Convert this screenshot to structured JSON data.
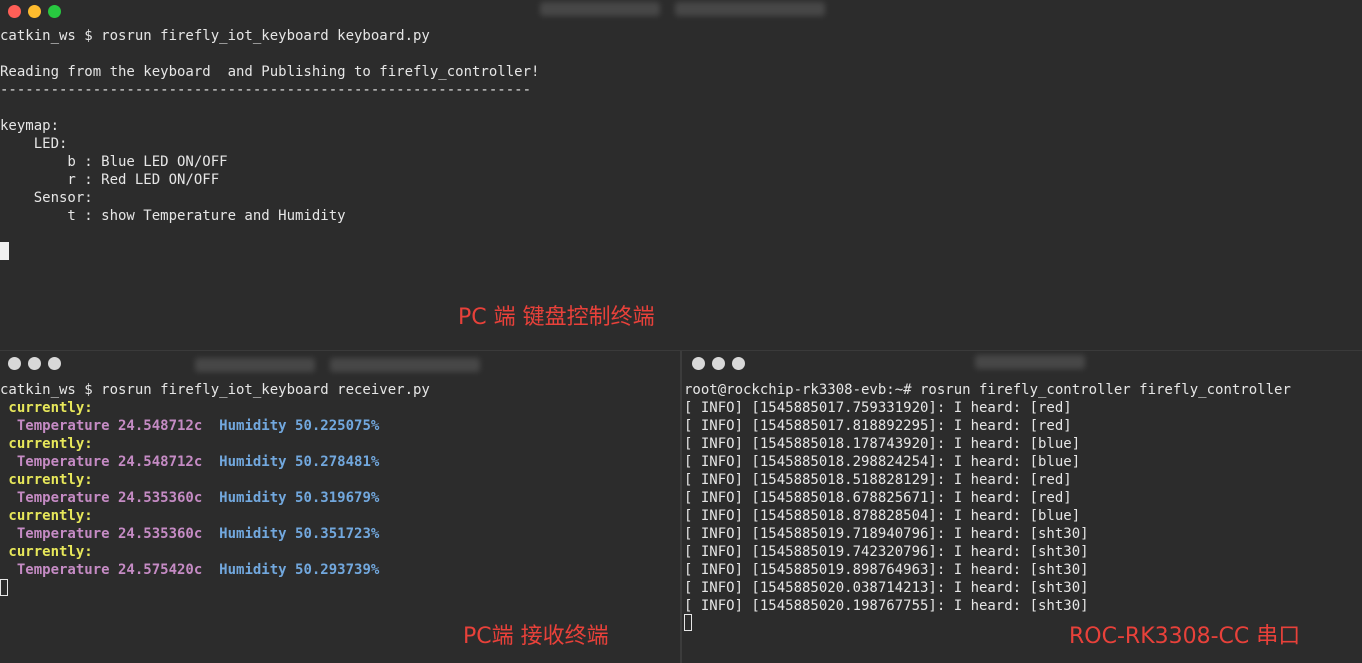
{
  "colors": {
    "close": "#ff5f57",
    "minimize": "#febc2e",
    "maximize": "#28c840",
    "inactive_dot": "#d8d8d8",
    "caption": "#e8413a",
    "currently": "#e7e75a",
    "temperature": "#c58bc4",
    "humidity": "#72a8de"
  },
  "keyboard_terminal": {
    "command": "catkin_ws $ rosrun firefly_iot_keyboard keyboard.py",
    "banner": "Reading from the keyboard  and Publishing to firefly_controller!",
    "separator": "---------------------------------------------------------------",
    "keymap_title": "keymap:",
    "led_title": "    LED:",
    "key_b": "        b : Blue LED ON/OFF",
    "key_r": "        r : Red LED ON/OFF",
    "sensor_title": "    Sensor:",
    "key_t": "        t : show Temperature and Humidity",
    "caption": "PC 端 键盘控制终端"
  },
  "receiver_terminal": {
    "command": "catkin_ws $ rosrun firefly_iot_keyboard receiver.py",
    "readings": [
      {
        "label": " currently:",
        "temperature": "  Temperature 24.548712c",
        "humidity": "Humidity 50.225075%"
      },
      {
        "label": " currently:",
        "temperature": "  Temperature 24.548712c",
        "humidity": "Humidity 50.278481%"
      },
      {
        "label": " currently:",
        "temperature": "  Temperature 24.535360c",
        "humidity": "Humidity 50.319679%"
      },
      {
        "label": " currently:",
        "temperature": "  Temperature 24.535360c",
        "humidity": "Humidity 50.351723%"
      },
      {
        "label": " currently:",
        "temperature": "  Temperature 24.575420c",
        "humidity": "Humidity 50.293739%"
      }
    ],
    "caption": "PC端 接收终端"
  },
  "serial_terminal": {
    "command": "root@rockchip-rk3308-evb:~# rosrun firefly_controller firefly_controller",
    "logs": [
      "[ INFO] [1545885017.759331920]: I heard: [red]",
      "[ INFO] [1545885017.818892295]: I heard: [red]",
      "[ INFO] [1545885018.178743920]: I heard: [blue]",
      "[ INFO] [1545885018.298824254]: I heard: [blue]",
      "[ INFO] [1545885018.518828129]: I heard: [red]",
      "[ INFO] [1545885018.678825671]: I heard: [red]",
      "[ INFO] [1545885018.878828504]: I heard: [blue]",
      "[ INFO] [1545885019.718940796]: I heard: [sht30]",
      "[ INFO] [1545885019.742320796]: I heard: [sht30]",
      "[ INFO] [1545885019.898764963]: I heard: [sht30]",
      "[ INFO] [1545885020.038714213]: I heard: [sht30]",
      "[ INFO] [1545885020.198767755]: I heard: [sht30]"
    ],
    "caption": "ROC-RK3308-CC 串口"
  }
}
